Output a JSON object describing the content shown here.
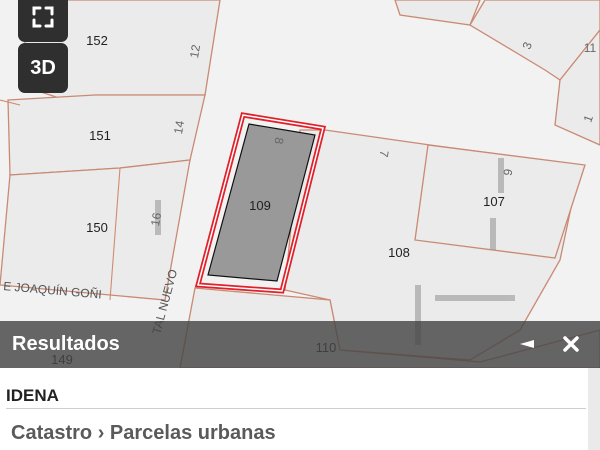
{
  "map": {
    "parcel_labels": [
      "152",
      "151",
      "150",
      "109",
      "107",
      "108",
      "110",
      "149"
    ],
    "house_numbers": [
      "12",
      "14",
      "16",
      "8",
      "7",
      "9",
      "3",
      "11",
      "1"
    ],
    "street_labels": [
      "E JOAQUÍN GOÑI",
      "TAL NUEVO"
    ],
    "selected_parcel": "109",
    "colors": {
      "background": "#f2f2f2",
      "parcel_fill": "#ebebeb",
      "parcel_border": "#c98a74",
      "selected_fill": "#999999",
      "selected_outline": "#e0202a",
      "street": "#ffffff",
      "building": "#8a8a8a"
    }
  },
  "controls": {
    "fullscreen_icon": "fullscreen-icon",
    "three_d_label": "3D"
  },
  "panel": {
    "title": "Resultados",
    "minimize_icon": "minimize-icon",
    "close_icon": "close-icon",
    "source": "IDENA",
    "breadcrumb": "Catastro › Parcelas urbanas"
  }
}
